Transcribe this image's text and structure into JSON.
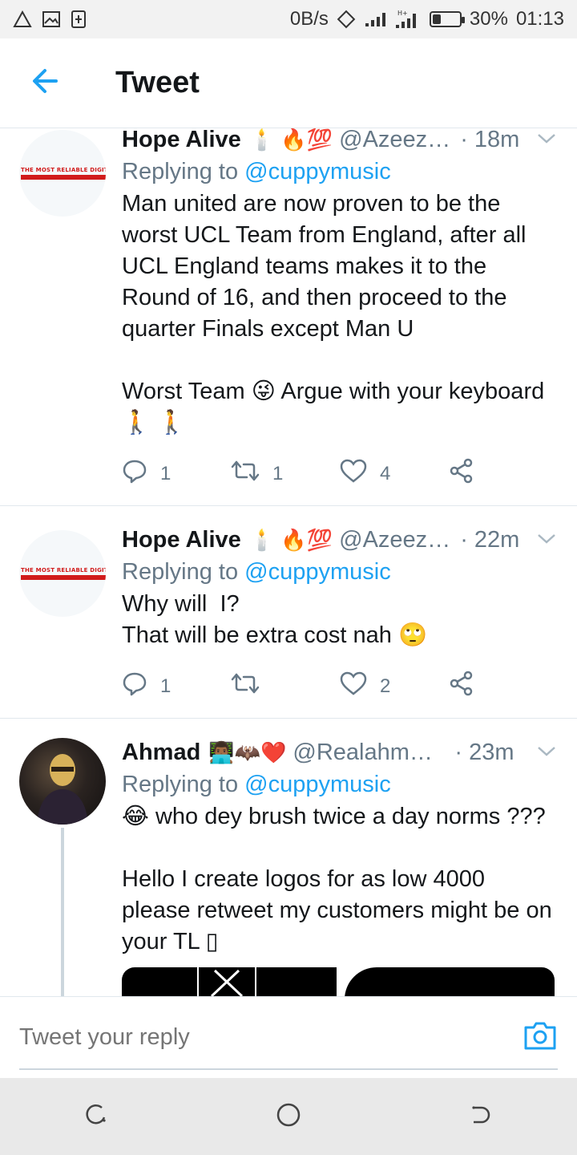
{
  "status_bar": {
    "net_speed": "0B/s",
    "battery": "30%",
    "battery_level": 0.3,
    "time": "01:13"
  },
  "header": {
    "title": "Tweet"
  },
  "tweets": [
    {
      "name": "Hope Alive",
      "emojis": "🕯️ 🔥💯",
      "handle": "@Azeez…",
      "time": "· 18m",
      "replying_prefix": "Replying to ",
      "replying_to": "@cuppymusic",
      "text": "Man united are now proven to be the worst UCL Team from England, after all UCL England teams makes it to the Round of 16, and then proceed to the quarter Finals except Man U\n\nWorst Team 😜 Argue with your keyboard 🚶 🚶",
      "avatar_text": "THE MOST RELIABLE DIGITAL MARKETER",
      "replies": "1",
      "retweets": "1",
      "likes": "4"
    },
    {
      "name": "Hope Alive",
      "emojis": "🕯️ 🔥💯",
      "handle": "@Azeez…",
      "time": "· 22m",
      "replying_prefix": "Replying to ",
      "replying_to": "@cuppymusic",
      "text": "Why will  I?\nThat will be extra cost nah 🙄",
      "avatar_text": "THE MOST RELIABLE DIGITAL MARKETER",
      "replies": "1",
      "retweets": "",
      "likes": "2"
    },
    {
      "name": "Ahmad",
      "emojis": "👨🏾‍💻🦇❤️",
      "handle": "@Realahma…",
      "time": "· 23m",
      "replying_prefix": "Replying to ",
      "replying_to": "@cuppymusic",
      "text": "😂 who dey brush twice a day norms ???\n\nHello I create logos for as low 4000 please retweet my customers might be on your TL ▯"
    }
  ],
  "reply_bar": {
    "placeholder": "Tweet your reply"
  },
  "colors": {
    "accent": "#1da1f2",
    "secondary_text": "#657786",
    "divider": "#e1e8ed"
  },
  "icons": [
    "back-arrow-icon",
    "caret-down-icon",
    "reply-icon",
    "retweet-icon",
    "like-icon",
    "share-icon",
    "camera-icon",
    "recents-icon",
    "home-icon",
    "back-icon"
  ]
}
